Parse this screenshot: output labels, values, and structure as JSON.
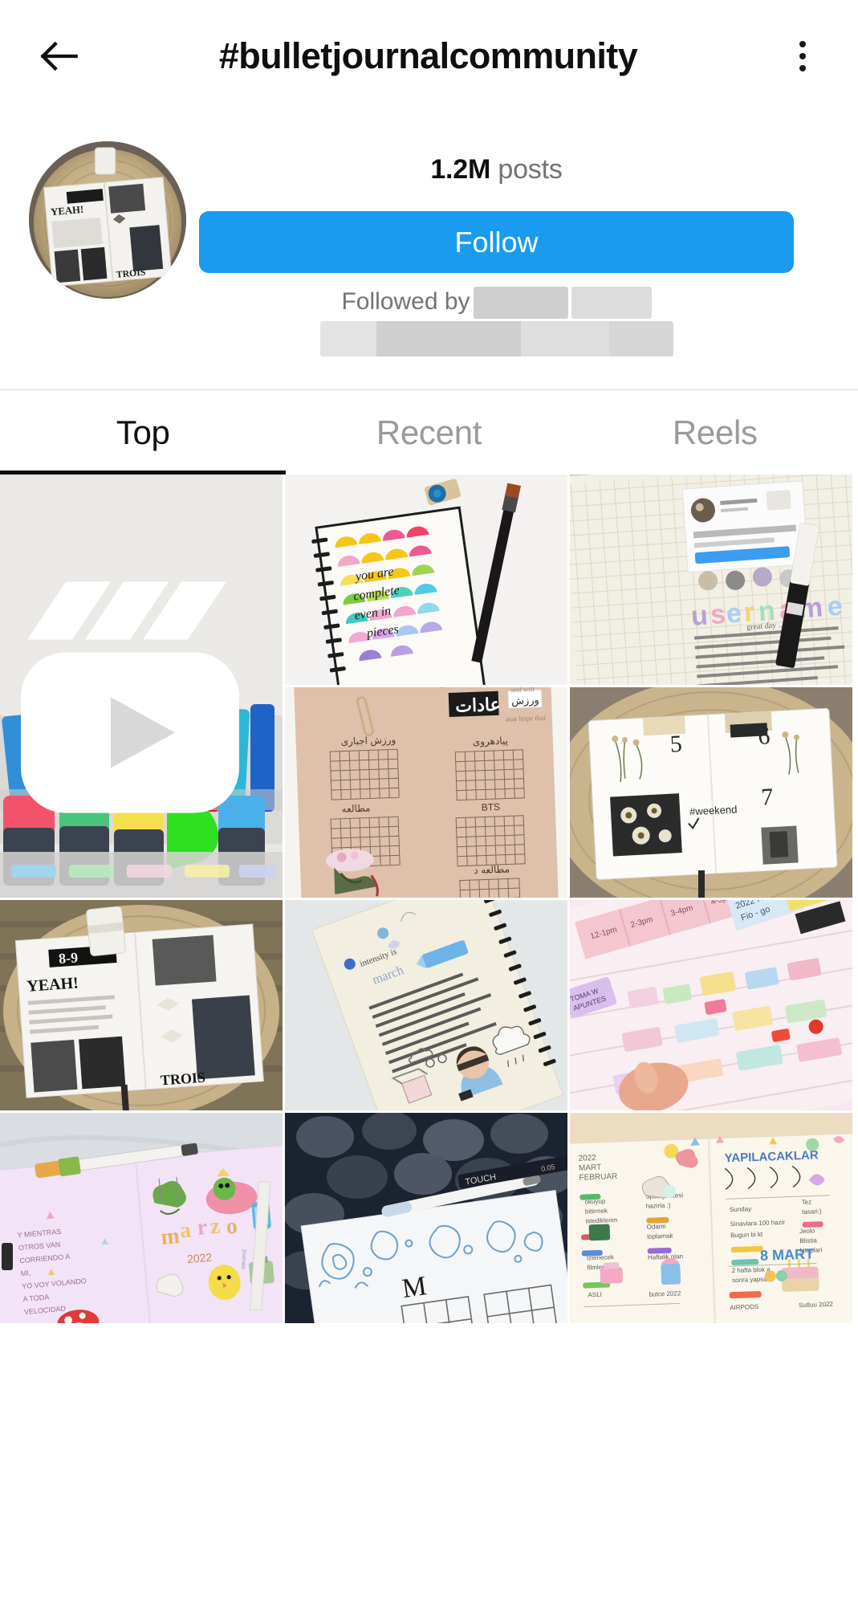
{
  "header": {
    "back_icon": "arrow-left-icon",
    "title": "#bulletjournalcommunity",
    "more_icon": "more-options-icon"
  },
  "profile": {
    "avatar_alt": "bullet-journal-collage-on-woven-mat",
    "posts_count": "1.2M",
    "posts_label": "posts",
    "follow_label": "Follow",
    "followed_by_label": "Followed by",
    "followed_by_names_redacted": true
  },
  "tabs": [
    {
      "id": "top",
      "label": "Top",
      "active": true
    },
    {
      "id": "recent",
      "label": "Recent",
      "active": false
    },
    {
      "id": "reels",
      "label": "Reels",
      "active": false
    }
  ],
  "grid": [
    {
      "id": "post-1",
      "alt": "colorful-highlighters-and-pens-in-clear-drawer",
      "badge": "reel-icon",
      "tall": true
    },
    {
      "id": "post-2",
      "alt": "spiral-notebook-scallop-watercolor-lettering-with-paintbrush",
      "badge": "none",
      "tall": false
    },
    {
      "id": "post-3",
      "alt": "grid-notebook-username-spread-with-brush-pen",
      "badge": "none",
      "tall": false
    },
    {
      "id": "post-4",
      "alt": "kraft-paper-habit-tracker-spread-with-paperclip-and-floral-sticker",
      "badge": "none",
      "tall": false
    },
    {
      "id": "post-5",
      "alt": "open-journal-on-woven-mat-with-dried-flowers-and-photo",
      "badge": "none",
      "tall": false
    },
    {
      "id": "post-6",
      "alt": "black-and-white-magazine-collage-journal-on-woven-mat",
      "badge": "none",
      "tall": false
    },
    {
      "id": "post-7",
      "alt": "cream-journal-page-with-kpop-sticker-and-handwriting",
      "badge": "none",
      "tall": false
    },
    {
      "id": "post-8",
      "alt": "pink-planner-with-colorful-sticky-tabs-held-in-hand",
      "badge": "none",
      "tall": false
    },
    {
      "id": "post-9",
      "alt": "marzo-2022-spanish-monthly-spread-with-cute-doodles",
      "badge": "carousel-icon",
      "tall": false
    },
    {
      "id": "post-10",
      "alt": "blue-paisley-doodle-monthly-grid-with-fineliner-on-pebbles",
      "badge": "none",
      "tall": false
    },
    {
      "id": "post-11",
      "alt": "turkish-colorful-todo-spread-8-mart",
      "badge": "none",
      "tall": false
    }
  ],
  "colors": {
    "accent_blue": "#1a9bf0",
    "text_primary": "#0f0f0f",
    "text_secondary": "#737373",
    "tab_inactive": "#9a9a9a",
    "divider": "#dbdbdb"
  }
}
